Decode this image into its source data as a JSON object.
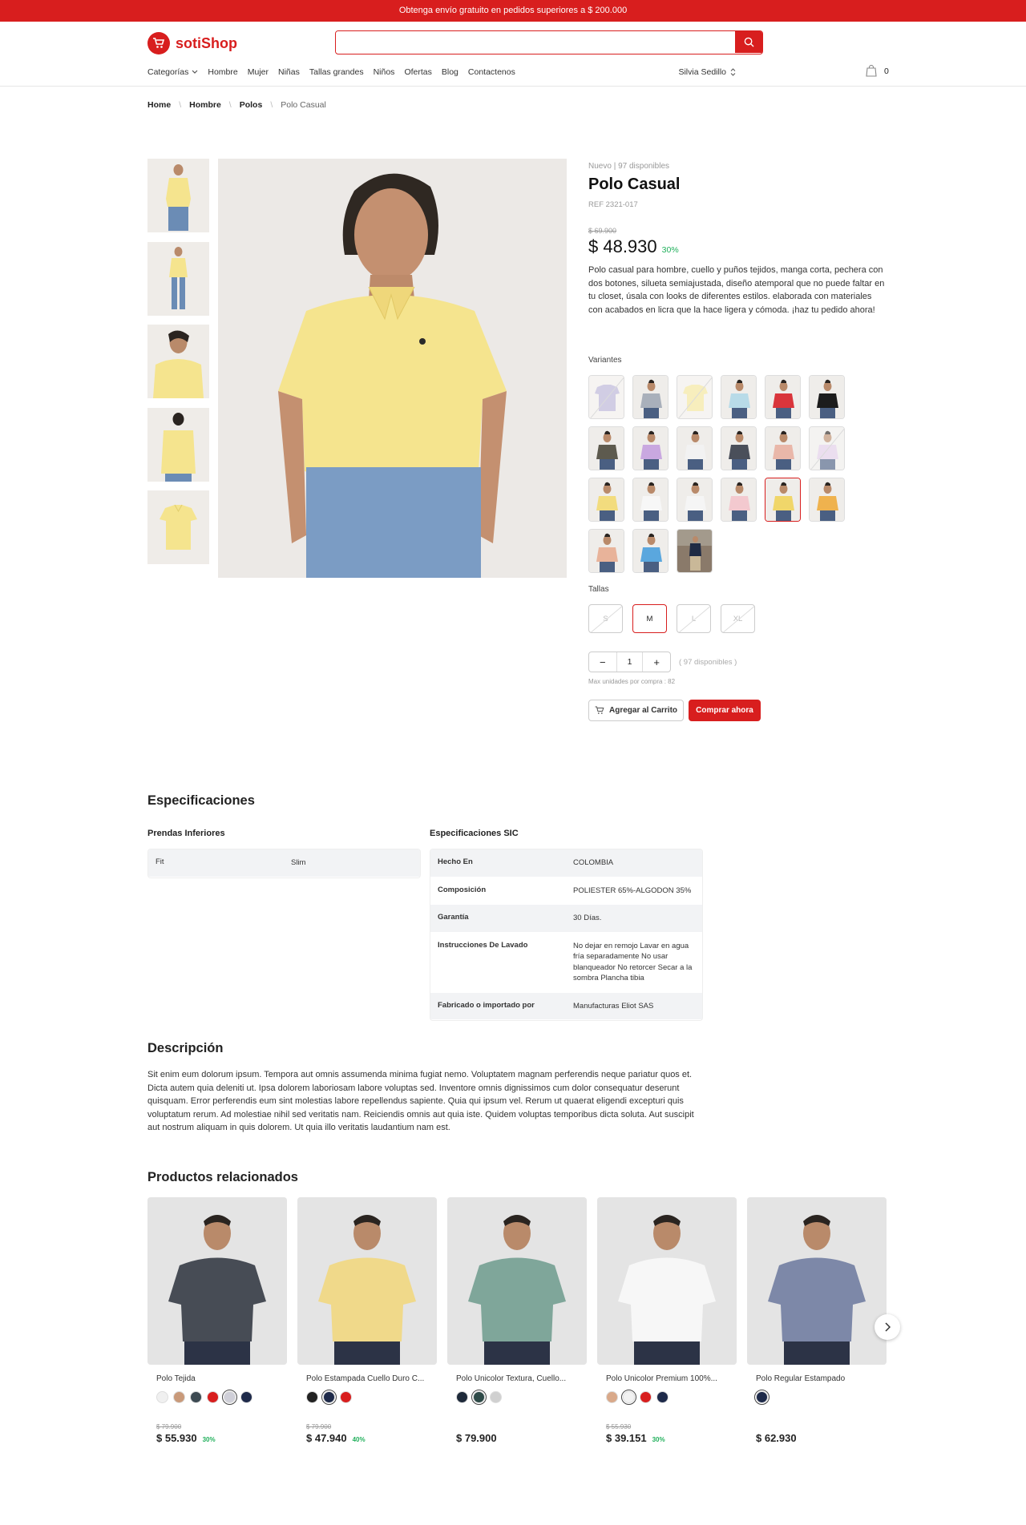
{
  "promo": {
    "text": "Obtenga envío gratuito en pedidos superiores a $ 200.000"
  },
  "header": {
    "logo_text": "sotiShop",
    "search_placeholder": "",
    "nav": [
      "Categorías",
      "Hombre",
      "Mujer",
      "Niñas",
      "Tallas grandes",
      "Niños",
      "Ofertas",
      "Blog",
      "Contactenos"
    ],
    "user_name": "Silvia Sedillo",
    "cart_count": "0"
  },
  "breadcrumb": [
    "Home",
    "Hombre",
    "Polos",
    "Polo Casual"
  ],
  "product": {
    "condition": "Nuevo",
    "availability": "97 disponibles",
    "title": "Polo Casual",
    "ref": "REF 2321-017",
    "old_price": "$ 69.900",
    "price": "$ 48.930",
    "discount": "30%",
    "description": "Polo casual para hombre, cuello y puños tejidos, manga corta, pechera con dos botones, silueta semiajustada, diseño atemporal que no puede faltar en tu closet, úsala con looks de diferentes estilos. elaborada con materiales con acabados en licra que la hace ligera y cómoda. ¡haz tu pedido ahora!",
    "variants_label": "Variantes",
    "variants": [
      {
        "color": "#b9b3d6",
        "unavailable": true,
        "kind": "folded"
      },
      {
        "color": "#a9b0bb",
        "unavailable": false,
        "kind": "man"
      },
      {
        "color": "#f3e59a",
        "unavailable": true,
        "kind": "folded"
      },
      {
        "color": "#b8dbe8",
        "unavailable": false,
        "kind": "man"
      },
      {
        "color": "#d9353b",
        "unavailable": false,
        "kind": "man"
      },
      {
        "color": "#1c1c1c",
        "unavailable": false,
        "kind": "man"
      },
      {
        "color": "#5d5a4e",
        "unavailable": false,
        "kind": "man"
      },
      {
        "color": "#c9a8e0",
        "unavailable": false,
        "kind": "man"
      },
      {
        "color": "#f2f2f2",
        "unavailable": false,
        "kind": "man"
      },
      {
        "color": "#4a4f5a",
        "unavailable": false,
        "kind": "man"
      },
      {
        "color": "#e9b7a9",
        "unavailable": false,
        "kind": "man"
      },
      {
        "color": "#e0cde6",
        "unavailable": true,
        "kind": "man"
      },
      {
        "color": "#f2dc7e",
        "unavailable": false,
        "kind": "man"
      },
      {
        "color": "#f7f7f7",
        "unavailable": false,
        "kind": "man"
      },
      {
        "color": "#f5f5f5",
        "unavailable": false,
        "kind": "man"
      },
      {
        "color": "#f3c9cf",
        "unavailable": false,
        "kind": "man"
      },
      {
        "color": "#f0d66a",
        "unavailable": false,
        "kind": "man",
        "selected": true
      },
      {
        "color": "#efb24e",
        "unavailable": false,
        "kind": "man"
      },
      {
        "color": "#e8b39a",
        "unavailable": false,
        "kind": "man"
      },
      {
        "color": "#5aa7de",
        "unavailable": false,
        "kind": "man"
      },
      {
        "color": "#1f2b44",
        "unavailable": false,
        "kind": "street"
      }
    ],
    "sizes_label": "Tallas",
    "sizes": [
      {
        "label": "S",
        "available": false,
        "selected": false
      },
      {
        "label": "M",
        "available": true,
        "selected": true
      },
      {
        "label": "L",
        "available": false,
        "selected": false
      },
      {
        "label": "XL",
        "available": false,
        "selected": false
      }
    ],
    "qty_minus": "−",
    "qty_value": "1",
    "qty_plus": "+",
    "qty_note": "( 97 disponibles )",
    "max_note": "Max unidades por compra : 82",
    "add_to_cart": "Agregar al Carrito",
    "buy_now": "Comprar ahora",
    "shirt_color": "#f5e48e"
  },
  "specs": {
    "title": "Especificaciones",
    "group1": {
      "title": "Prendas Inferiores",
      "rows": [
        {
          "k": "Fit",
          "v": "Slim"
        }
      ]
    },
    "group2": {
      "title": "Especificaciones SIC",
      "rows": [
        {
          "k": "Hecho En",
          "v": "COLOMBIA"
        },
        {
          "k": "Composición",
          "v": "POLIESTER 65%-ALGODON 35%"
        },
        {
          "k": "Garantía",
          "v": "30 Días."
        },
        {
          "k": "Instrucciones De Lavado",
          "v": "No dejar en remojo Lavar en agua fría separadamente No usar blanqueador No retorcer Secar a la sombra Plancha tibia"
        },
        {
          "k": "Fabricado o importado por",
          "v": "Manufacturas Eliot SAS"
        }
      ]
    }
  },
  "description": {
    "title": "Descripción",
    "body": "Sit enim eum dolorum ipsum. Tempora aut omnis assumenda minima fugiat nemo. Voluptatem magnam perferendis neque pariatur quos et. Dicta autem quia deleniti ut. Ipsa dolorem laboriosam labore voluptas sed. Inventore omnis dignissimos cum dolor consequatur deserunt quisquam. Error perferendis eum sint molestias labore repellendus sapiente. Quia qui ipsum vel. Rerum ut quaerat eligendi excepturi quis voluptatum rerum. Ad molestiae nihil sed veritatis nam. Reiciendis omnis aut quia iste. Quidem voluptas temporibus dicta soluta. Aut suscipit aut nostrum aliquam in quis dolorem. Ut quia illo veritatis laudantium nam est."
  },
  "related": {
    "title": "Productos relacionados",
    "products": [
      {
        "name": "Polo Tejida",
        "old_price": "$ 79.900",
        "price": "$ 55.930",
        "discount": "30%",
        "shirt": "#474c55",
        "swatches": [
          "#f0f0f0",
          "#c99a7a",
          "#3d4a52",
          "#d81e1e",
          "#cfcfd8",
          "#1e2a4a"
        ],
        "selected_swatch": 4
      },
      {
        "name": "Polo Estampada Cuello Duro C...",
        "old_price": "$ 79.900",
        "price": "$ 47.940",
        "discount": "40%",
        "shirt": "#f0d98a",
        "swatches": [
          "#222",
          "#1e2a4a",
          "#d81e1e"
        ],
        "selected_swatch": 1
      },
      {
        "name": "Polo Unicolor Textura, Cuello...",
        "old_price": "",
        "price": "$ 79.900",
        "discount": "",
        "shirt": "#7fa69a",
        "swatches": [
          "#1e2a3a",
          "#2e4a48",
          "#d0d0d0"
        ],
        "selected_swatch": 1
      },
      {
        "name": "Polo Unicolor Premium 100%...",
        "old_price": "$ 55.930",
        "price": "$ 39.151",
        "discount": "30%",
        "shirt": "#f7f7f7",
        "swatches": [
          "#d9a98a",
          "#f2f2f2",
          "#d81e1e",
          "#1e2a4a"
        ],
        "selected_swatch": 1
      },
      {
        "name": "Polo Regular Estampado",
        "old_price": "",
        "price": "$ 62.930",
        "discount": "",
        "shirt": "#7d88a8",
        "swatches": [
          "#1e2a4a"
        ],
        "selected_swatch": 0
      }
    ]
  }
}
